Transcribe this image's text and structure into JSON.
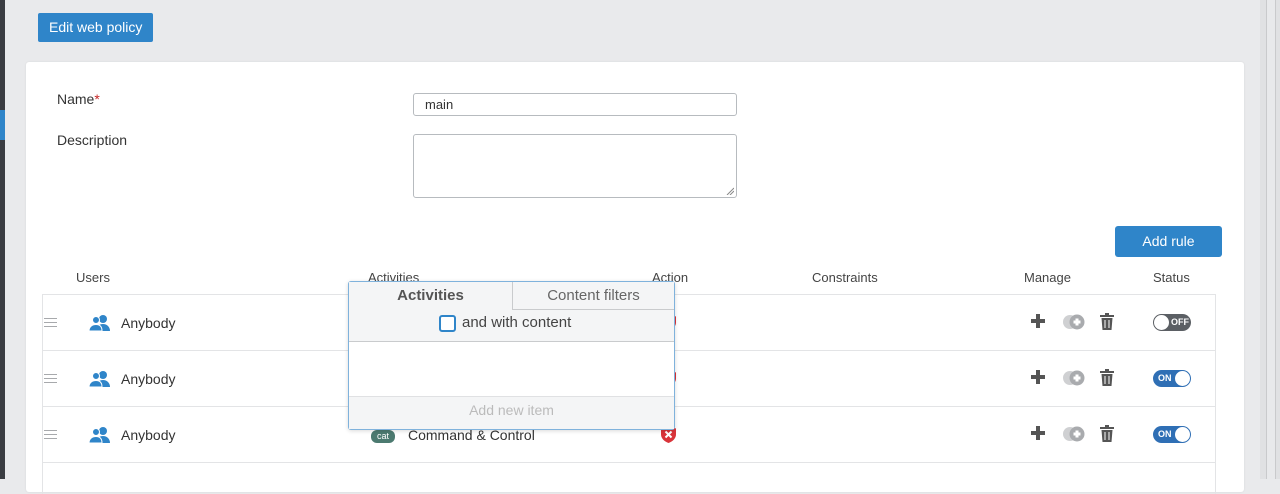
{
  "dialog": {
    "title": "Edit web policy",
    "name_label": "Name",
    "required_mark": "*",
    "name_value": "main",
    "description_label": "Description",
    "description_value": "",
    "add_rule_label": "Add rule"
  },
  "table": {
    "headers": {
      "users": "Users",
      "activities": "Activities",
      "action": "Action",
      "constraints": "Constraints",
      "manage": "Manage",
      "status": "Status"
    },
    "rows": [
      {
        "user": "Anybody",
        "activity_badge": "",
        "activity": "",
        "action": "block",
        "status": "OFF"
      },
      {
        "user": "Anybody",
        "activity_badge": "",
        "activity": "",
        "action": "block",
        "status": "ON"
      },
      {
        "user": "Anybody",
        "activity_badge": "cat",
        "activity": "Command & Control",
        "action": "block",
        "status": "ON"
      }
    ]
  },
  "popup": {
    "tab_activities": "Activities",
    "tab_content_filters": "Content filters",
    "checkbox_label": "and with content",
    "checkbox_checked": false,
    "add_new_item": "Add new item"
  },
  "icons": {
    "user": "users-icon",
    "action": "block-shield-icon",
    "manage": [
      "plus-icon",
      "duplicate-icon",
      "trash-icon"
    ]
  },
  "colors": {
    "accent": "#2f85c9",
    "toggle_on": "#2f6fb5",
    "toggle_off": "#5b5f64",
    "block_red": "#d9343a",
    "category_badge": "#4c7a70"
  }
}
